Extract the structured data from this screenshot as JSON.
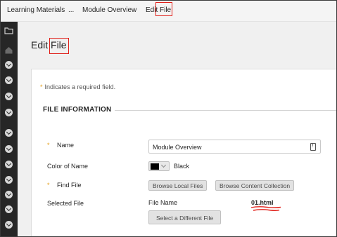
{
  "breadcrumb": {
    "items": [
      "Learning Materials",
      "...",
      "Module Overview",
      "Edit File"
    ]
  },
  "page": {
    "title": "Edit File"
  },
  "form": {
    "required_note": "Indicates a required field.",
    "required_marker": "*",
    "section_title": "FILE INFORMATION",
    "name": {
      "label": "Name",
      "value": "Module Overview"
    },
    "color": {
      "label": "Color of Name",
      "value": "Black",
      "swatch": "#000000"
    },
    "find_file": {
      "label": "Find File",
      "browse_local": "Browse Local Files",
      "browse_collection": "Browse Content Collection"
    },
    "selected_file": {
      "label": "Selected File",
      "file_name_label": "File Name",
      "file_name_value": "01.html",
      "select_different": "Select a Different File"
    }
  },
  "left_rail": {
    "icons": [
      "folder-icon",
      "home-icon",
      "chevron-circle-icon",
      "chevron-circle-icon",
      "chevron-circle-icon",
      "chevron-circle-icon",
      "chevron-circle-icon",
      "chevron-circle-icon",
      "chevron-circle-icon",
      "chevron-circle-icon",
      "chevron-circle-icon",
      "chevron-circle-icon",
      "chevron-circle-icon",
      "chevron-circle-icon"
    ]
  },
  "colors": {
    "annotation_red": "#e0201a",
    "required_star": "#e6a01c",
    "rail_bg": "#262626"
  }
}
